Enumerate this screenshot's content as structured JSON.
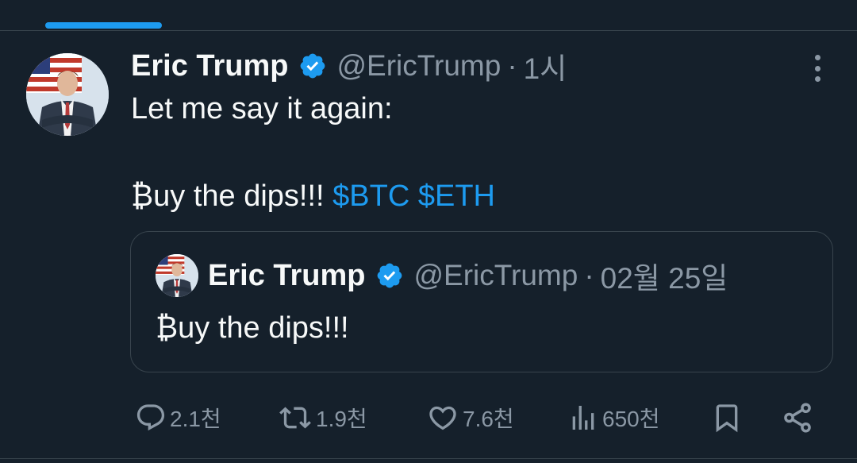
{
  "author": {
    "name": "Eric Trump",
    "handle": "@EricTrump",
    "time": "1시",
    "dot": "·"
  },
  "tweet": {
    "line1": "Let me say it again:",
    "line2_text": "₿uy the dips!!! ",
    "cashtags": [
      "$BTC",
      "$ETH"
    ]
  },
  "quoted": {
    "name": "Eric Trump",
    "handle": "@EricTrump",
    "dot": "·",
    "time": "02월 25일",
    "text": "₿uy the dips!!!"
  },
  "actions": {
    "replies": "2.1천",
    "retweets": "1.9천",
    "likes": "7.6천",
    "views": "650천"
  },
  "colors": {
    "background": "#15202b",
    "accent": "#1d9bf0",
    "muted": "#8b98a5",
    "text": "#f7f9f9",
    "border": "#38444d"
  },
  "icons": {
    "verified": "verified-badge-icon",
    "more": "more-vertical-icon",
    "reply": "reply-icon",
    "retweet": "retweet-icon",
    "like": "heart-icon",
    "views": "views-chart-icon",
    "bookmark": "bookmark-icon",
    "share": "share-icon"
  }
}
